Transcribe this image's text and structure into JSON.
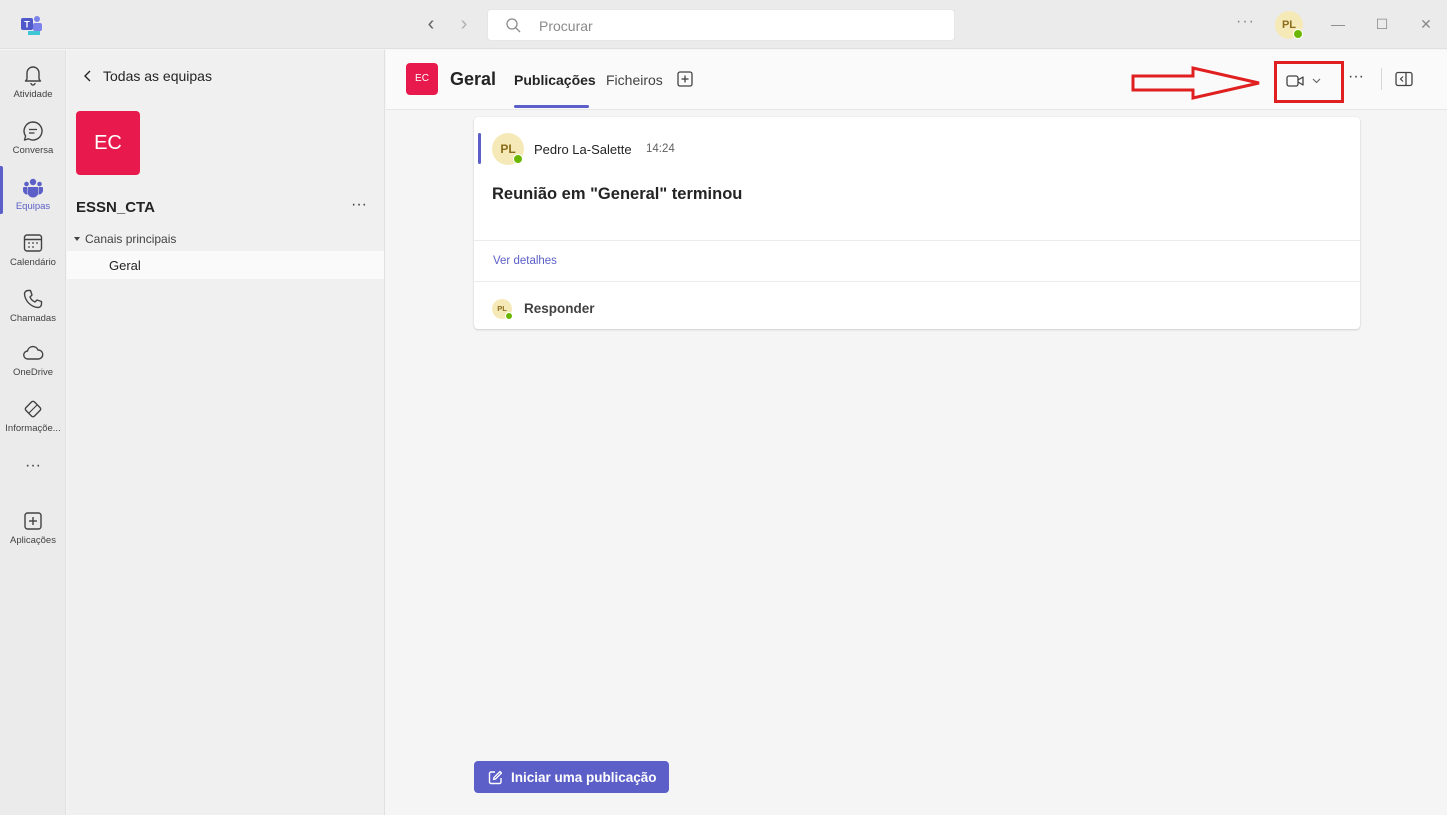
{
  "titlebar": {
    "search_placeholder": "Procurar",
    "more_label": "···",
    "avatar_initials": "PL"
  },
  "rail": {
    "items": [
      {
        "label": "Atividade",
        "icon": "bell-icon"
      },
      {
        "label": "Conversa",
        "icon": "chat-icon"
      },
      {
        "label": "Equipas",
        "icon": "teams-icon"
      },
      {
        "label": "Calendário",
        "icon": "calendar-icon"
      },
      {
        "label": "Chamadas",
        "icon": "phone-icon"
      },
      {
        "label": "OneDrive",
        "icon": "cloud-icon"
      },
      {
        "label": "Informaçõe...",
        "icon": "info-app-icon"
      },
      {
        "label": "Aplicações",
        "icon": "plus-square-icon"
      }
    ],
    "more_label": "···",
    "active_index": 2
  },
  "panel": {
    "back_label": "Todas as equipas",
    "team_tile": "EC",
    "team_name": "ESSN_CTA",
    "team_more": "···",
    "channel_group": "Canais principais",
    "channels": [
      {
        "label": "Geral"
      }
    ]
  },
  "channel": {
    "tile": "EC",
    "title": "Geral",
    "tabs": [
      {
        "label": "Publicações",
        "active": true
      },
      {
        "label": "Ficheiros",
        "active": false
      }
    ],
    "more": "···"
  },
  "post": {
    "author_initials": "PL",
    "author": "Pedro La-Salette",
    "time": "14:24",
    "body": "Reunião em \"General\" terminou",
    "details_link": "Ver detalhes",
    "reply_initials": "PL",
    "reply_label": "Responder"
  },
  "compose": {
    "start_post_label": "Iniciar uma publicação"
  },
  "colors": {
    "accent": "#5b5fc7",
    "team_tile": "#e8194c",
    "annotation": "#e02020",
    "presence": "#6bb700"
  }
}
